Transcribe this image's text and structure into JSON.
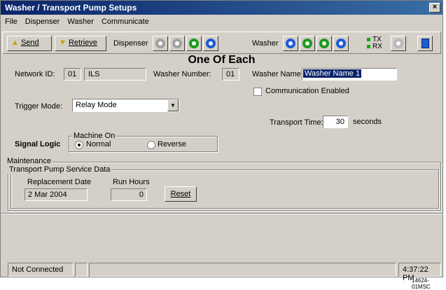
{
  "window": {
    "title": "Washer / Transport Pump Setups",
    "close": "×"
  },
  "menu": [
    {
      "label": "File"
    },
    {
      "label": "Dispenser"
    },
    {
      "label": "Washer"
    },
    {
      "label": "Communicate"
    }
  ],
  "toolbar": {
    "send_label": "Send",
    "retrieve_label": "Retrieve",
    "dispenser_label": "Dispenser",
    "washer_label": "Washer",
    "tx_label": "TX",
    "rx_label": "RX"
  },
  "form": {
    "heading": "One Of Each",
    "network_id_label": "Network ID:",
    "network_id_value": "01",
    "network_name_value": "ILS",
    "washer_number_label": "Washer Number:",
    "washer_number_value": "01",
    "washer_name_label": "Washer Name:",
    "washer_name_value": "Washer Name 1",
    "comm_enabled_label": "Communication Enabled",
    "trigger_mode_label": "Trigger Mode:",
    "trigger_mode_value": "Relay Mode",
    "transport_time_label": "Transport Time:",
    "transport_time_value": "30",
    "transport_time_unit": "seconds",
    "signal_logic_label": "Signal Logic",
    "machine_on_label": "Machine On",
    "normal_label": "Normal",
    "reverse_label": "Reverse"
  },
  "maintenance": {
    "title": "Maintenance",
    "service_title": "Transport Pump Service Data",
    "replacement_date_label": "Replacement Date",
    "replacement_date_value": "2 Mar 2004",
    "run_hours_label": "Run Hours",
    "run_hours_value": "0",
    "reset_label": "Reset"
  },
  "status": {
    "connection": "Not Connected",
    "time": "4:37:22 PM"
  },
  "footer_code": "14624-01MSC",
  "colors": {
    "accent": "#0a246a",
    "led_green": "#00b000",
    "icon_blue": "#1c5ad6",
    "icon_green": "#1a9a1a"
  }
}
